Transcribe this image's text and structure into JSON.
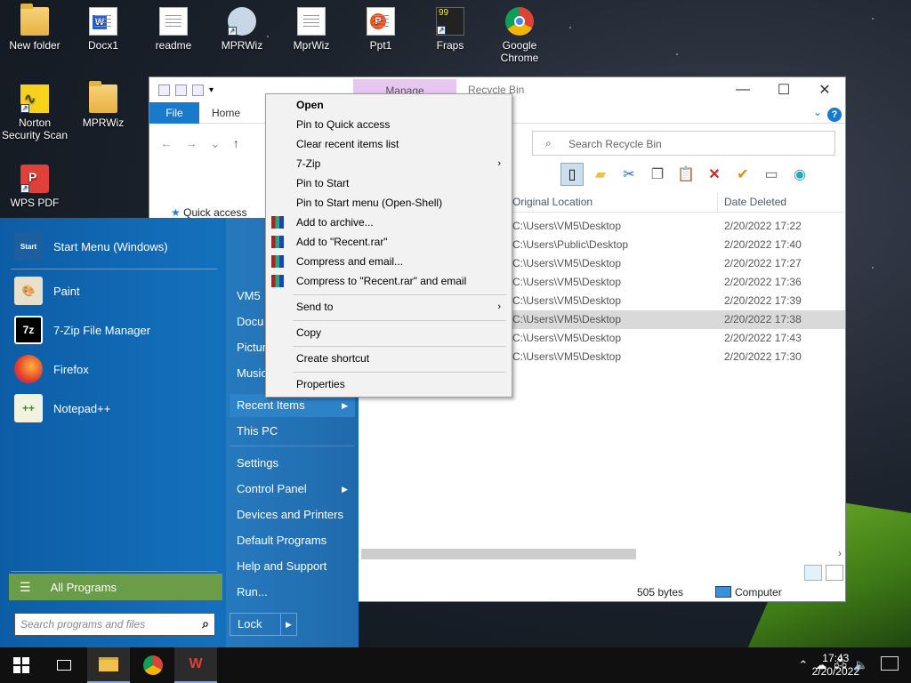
{
  "desktop": {
    "icons": [
      {
        "label": "New folder",
        "icon": "folder-icon"
      },
      {
        "label": "Docx1",
        "icon": "docx-icon"
      },
      {
        "label": "readme",
        "icon": "text-file-icon"
      },
      {
        "label": "MPRWiz",
        "icon": "mprwiz-app-icon"
      },
      {
        "label": "MprWiz",
        "icon": "text-file-icon"
      },
      {
        "label": "Ppt1",
        "icon": "pptx-icon"
      },
      {
        "label": "Fraps",
        "icon": "fraps-icon"
      },
      {
        "label": "Google Chrome",
        "icon": "chrome-icon"
      },
      {
        "label": "Norton Security Scan",
        "icon": "norton-icon"
      },
      {
        "label": "MPRWiz",
        "icon": "folder-icon"
      },
      {
        "label": "WPS PDF",
        "icon": "wps-pdf-icon"
      }
    ]
  },
  "explorer": {
    "manage_label": "Manage",
    "title": "Recycle Bin",
    "tabs": {
      "file": "File",
      "home": "Home"
    },
    "search_placeholder": "Search Recycle Bin",
    "quick_access": "Quick access",
    "columns": {
      "original_location": "Original Location",
      "date_deleted": "Date Deleted"
    },
    "rows": [
      {
        "loc": "C:\\Users\\VM5\\Desktop",
        "date": "2/20/2022 17:22"
      },
      {
        "loc": "C:\\Users\\Public\\Desktop",
        "date": "2/20/2022 17:40"
      },
      {
        "loc": "C:\\Users\\VM5\\Desktop",
        "date": "2/20/2022 17:27"
      },
      {
        "loc": "C:\\Users\\VM5\\Desktop",
        "date": "2/20/2022 17:36"
      },
      {
        "loc": "C:\\Users\\VM5\\Desktop",
        "date": "2/20/2022 17:39"
      },
      {
        "loc": "C:\\Users\\VM5\\Desktop",
        "date": "2/20/2022 17:38"
      },
      {
        "loc": "C:\\Users\\VM5\\Desktop",
        "date": "2/20/2022 17:43"
      },
      {
        "loc": "C:\\Users\\VM5\\Desktop",
        "date": "2/20/2022 17:30"
      }
    ],
    "status": {
      "size": "505 bytes",
      "zone": "Computer"
    }
  },
  "start_menu": {
    "pinned": [
      {
        "label": "Start Menu (Windows)",
        "icon": "start-menu-icon"
      },
      {
        "label": "Paint",
        "icon": "paint-icon"
      },
      {
        "label": "7-Zip File Manager",
        "icon": "7zip-icon"
      },
      {
        "label": "Firefox",
        "icon": "firefox-icon"
      },
      {
        "label": "Notepad++",
        "icon": "notepadpp-icon"
      }
    ],
    "all_programs": "All Programs",
    "search_placeholder": "Search programs and files",
    "right_items": [
      "VM5",
      "Docu",
      "Pictur",
      "Music",
      "Recent Items",
      "This PC",
      "Settings",
      "Control Panel",
      "Devices and Printers",
      "Default Programs",
      "Help and Support",
      "Run..."
    ],
    "lock": "Lock"
  },
  "context_menu": {
    "items": [
      "Open",
      "Pin to Quick access",
      "Clear recent items list",
      "7-Zip",
      "Pin to Start",
      "Pin to Start menu (Open-Shell)",
      "Add to archive...",
      "Add to \"Recent.rar\"",
      "Compress and email...",
      "Compress to \"Recent.rar\" and email",
      "Send to",
      "Copy",
      "Create shortcut",
      "Properties"
    ]
  },
  "taskbar": {
    "time": "17:43",
    "date": "2/20/2022"
  },
  "colors": {
    "start_bg": "#1570bb",
    "all_programs": "#6b9c48",
    "file_tab": "#1979ca",
    "selection": "#d9d9d9"
  }
}
